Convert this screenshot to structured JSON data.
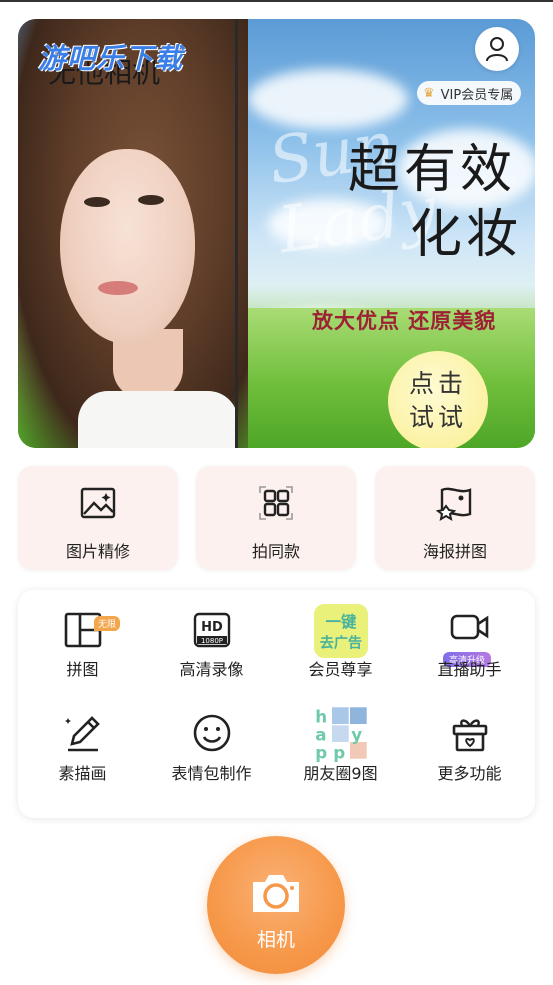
{
  "app": {
    "watermark": "游吧乐下载",
    "name": "无他相机"
  },
  "banner": {
    "vip_badge": "VIP会员专属",
    "script_text": "Sun Lady",
    "headline_line1": "超有效",
    "headline_line2": "化妆",
    "tagline": "放大优点 还原美貌",
    "try_line1": "点击",
    "try_line2": "试试"
  },
  "features": [
    {
      "label": "图片精修",
      "icon": "image-edit-icon"
    },
    {
      "label": "拍同款",
      "icon": "grid-frame-icon"
    },
    {
      "label": "海报拼图",
      "icon": "poster-icon"
    }
  ],
  "tools": [
    {
      "label": "拼图",
      "icon": "collage-icon",
      "tag": "无限"
    },
    {
      "label": "高清录像",
      "icon": "hd-video-icon",
      "tag": "1080P"
    },
    {
      "label": "会员尊享",
      "icon": "vip-adfree-icon",
      "tag_line1": "一键",
      "tag_line2": "去广告"
    },
    {
      "label": "直播助手",
      "icon": "live-camera-icon",
      "tag": "高清升级"
    },
    {
      "label": "素描画",
      "icon": "pencil-icon"
    },
    {
      "label": "表情包制作",
      "icon": "smiley-icon"
    },
    {
      "label": "朋友圈9图",
      "icon": "nine-grid-icon",
      "tag_text": "happy"
    },
    {
      "label": "更多功能",
      "icon": "gift-box-icon"
    }
  ],
  "camera": {
    "label": "相机"
  },
  "colors": {
    "accent": "#f69849",
    "card_bg": "#fcf1ee",
    "tagline": "#9d2035"
  }
}
